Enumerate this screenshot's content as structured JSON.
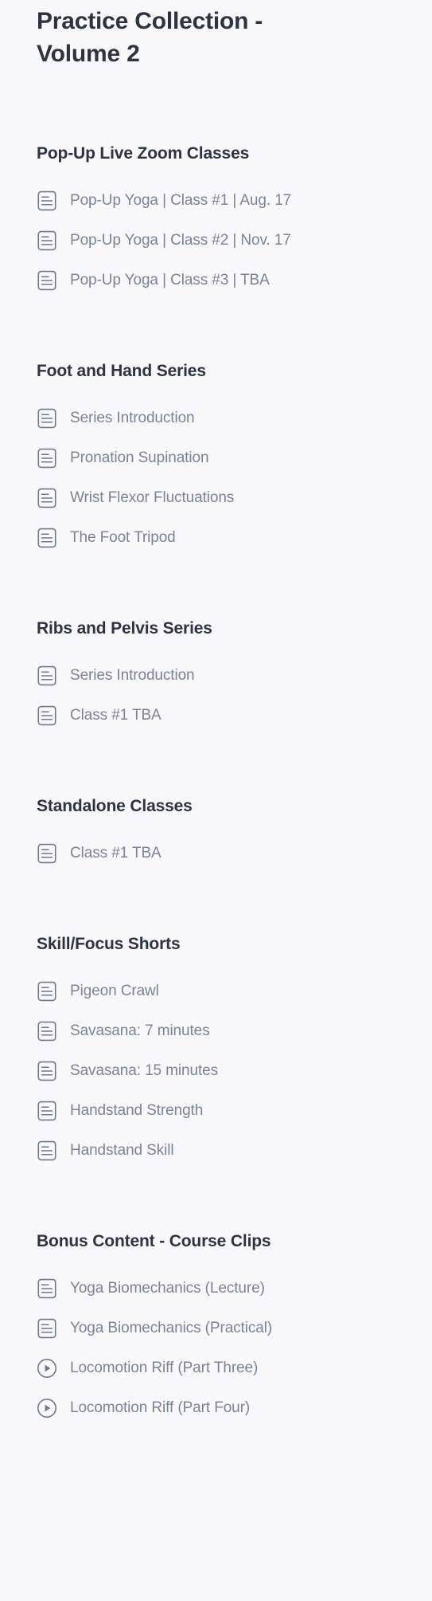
{
  "page": {
    "title": "Practice Collection - Volume 2",
    "background_color": "#f8f8fc",
    "heading_color": "#2e3340",
    "item_text_color": "#7b8494",
    "icon_color": "#6e7a8a"
  },
  "sections": [
    {
      "title": "Pop-Up Live Zoom Classes",
      "items": [
        {
          "label": "Pop-Up Yoga | Class #1 | Aug. 17",
          "icon": "document-lines-icon"
        },
        {
          "label": "Pop-Up Yoga | Class #2 | Nov. 17",
          "icon": "document-lines-icon"
        },
        {
          "label": "Pop-Up Yoga | Class #3 | TBA",
          "icon": "document-lines-icon"
        }
      ]
    },
    {
      "title": "Foot and Hand Series",
      "items": [
        {
          "label": "Series Introduction",
          "icon": "document-lines-icon"
        },
        {
          "label": "Pronation Supination",
          "icon": "document-lines-icon"
        },
        {
          "label": "Wrist Flexor Fluctuations",
          "icon": "document-lines-icon"
        },
        {
          "label": "The Foot Tripod",
          "icon": "document-lines-icon"
        }
      ]
    },
    {
      "title": "Ribs and Pelvis Series",
      "items": [
        {
          "label": "Series Introduction",
          "icon": "document-lines-icon"
        },
        {
          "label": "Class #1 TBA",
          "icon": "document-lines-icon"
        }
      ]
    },
    {
      "title": "Standalone Classes",
      "items": [
        {
          "label": "Class #1 TBA",
          "icon": "document-lines-icon"
        }
      ]
    },
    {
      "title": "Skill/Focus Shorts",
      "items": [
        {
          "label": "Pigeon Crawl",
          "icon": "document-lines-icon"
        },
        {
          "label": "Savasana: 7 minutes",
          "icon": "document-lines-icon"
        },
        {
          "label": "Savasana: 15 minutes",
          "icon": "document-lines-icon"
        },
        {
          "label": "Handstand Strength",
          "icon": "document-lines-icon"
        },
        {
          "label": "Handstand Skill",
          "icon": "document-lines-icon"
        }
      ]
    },
    {
      "title": "Bonus Content - Course Clips",
      "items": [
        {
          "label": "Yoga Biomechanics (Lecture)",
          "icon": "document-lines-icon"
        },
        {
          "label": "Yoga Biomechanics (Practical)",
          "icon": "document-lines-icon"
        },
        {
          "label": "Locomotion Riff (Part Three)",
          "icon": "play-circle-icon"
        },
        {
          "label": "Locomotion Riff (Part Four)",
          "icon": "play-circle-icon"
        }
      ]
    }
  ]
}
